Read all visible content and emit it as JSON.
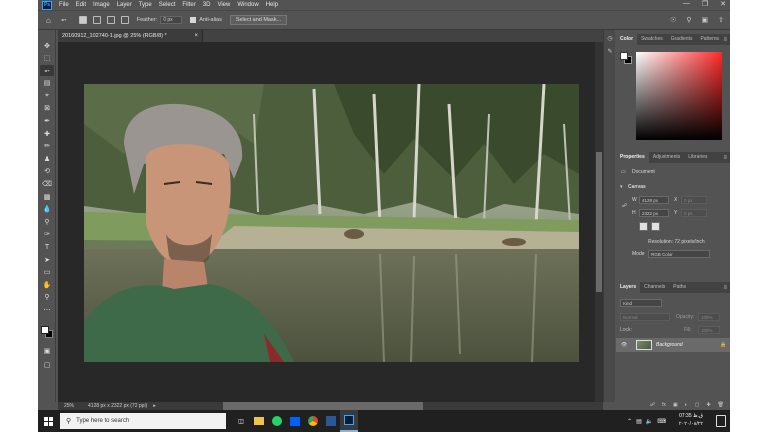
{
  "menubar": {
    "logo": "Ps",
    "items": [
      "File",
      "Edit",
      "Image",
      "Layer",
      "Type",
      "Select",
      "Filter",
      "3D",
      "View",
      "Window",
      "Help"
    ]
  },
  "options": {
    "feather_label": "Feather:",
    "feather_value": "0 px",
    "anti_alias_label": "Anti-alias",
    "select_mask_label": "Select and Mask..."
  },
  "document": {
    "tab_title": "20160912_102740-1.jpg @ 25% (RGB/8) *",
    "zoom": "25%",
    "dimensions": "4128 px x 2322 px (72 ppi)"
  },
  "color_panel": {
    "tabs": [
      "Color",
      "Swatches",
      "Gradients",
      "Patterns"
    ]
  },
  "properties_panel": {
    "tabs": [
      "Properties",
      "Adjustments",
      "Libraries"
    ],
    "document_label": "Document",
    "canvas_label": "Canvas",
    "width_label": "W",
    "width_value": "4128 px",
    "height_label": "H",
    "height_value": "2322 px",
    "x_label": "X",
    "x_value": "0 px",
    "y_label": "Y",
    "y_value": "0 px",
    "resolution": "Resolution: 72 pixels/inch",
    "mode_label": "Mode",
    "mode_value": "RGB Color"
  },
  "layers_panel": {
    "tabs": [
      "Layers",
      "Channels",
      "Paths"
    ],
    "kind_placeholder": "Kind",
    "blend_mode": "Normal",
    "opacity_label": "Opacity:",
    "opacity_value": "100%",
    "lock_label": "Lock:",
    "fill_label": "Fill:",
    "fill_value": "100%",
    "layer_name": "Background"
  },
  "taskbar": {
    "search_placeholder": "Type here to search",
    "clock_time": "07:35 ق.ظ",
    "clock_date": "۲۰۲۰/۰۸/۲۲"
  },
  "colors": {
    "workspace": "#535353",
    "canvas_bg": "#282828",
    "taskbar": "#202020",
    "accent": "#31a8ff"
  }
}
